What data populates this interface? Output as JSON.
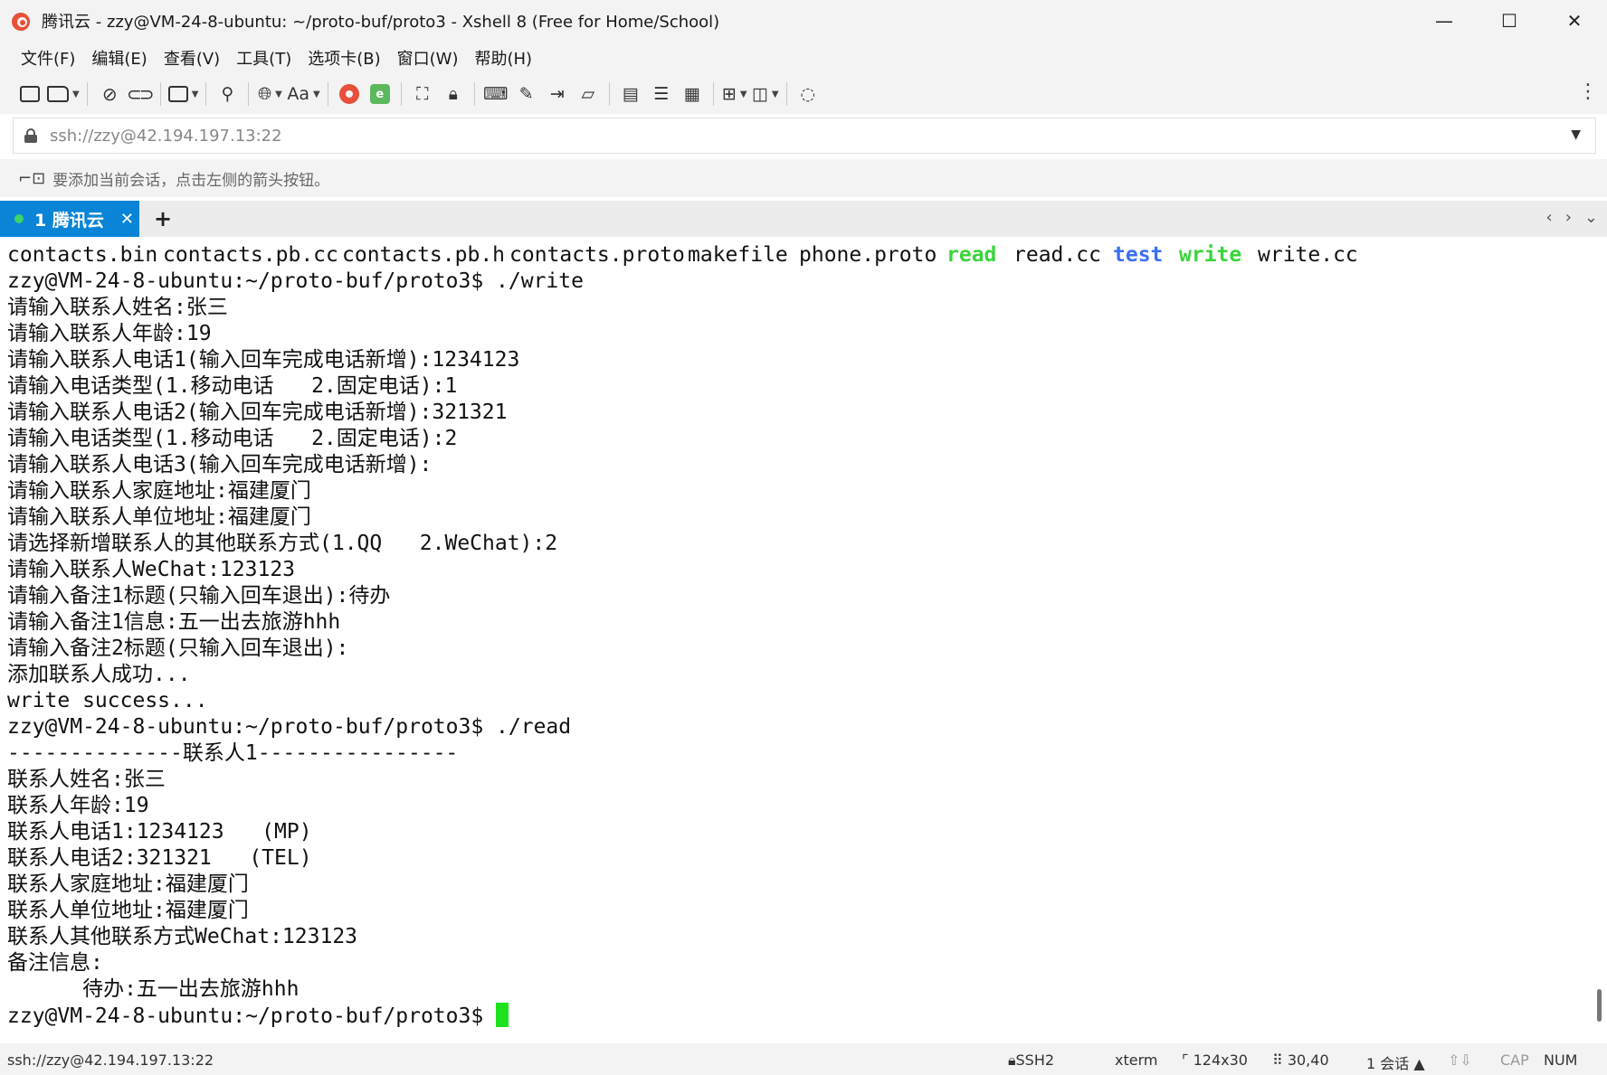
{
  "window": {
    "title": "腾讯云 - zzy@VM-24-8-ubuntu: ~/proto-buf/proto3 - Xshell 8 (Free for Home/School)",
    "app_icon": "xshell-logo-icon",
    "controls": {
      "minimize": "—",
      "maximize": "☐",
      "close": "✕"
    }
  },
  "menu": {
    "items": [
      "文件(F)",
      "编辑(E)",
      "查看(V)",
      "工具(T)",
      "选项卡(B)",
      "窗口(W)",
      "帮助(H)"
    ]
  },
  "toolbar": {
    "font_label": "Aa",
    "more": "⋮",
    "icons": [
      "new-session-icon",
      "open-folder-icon",
      "disconnect-icon",
      "reconnect-icon",
      "new-tab-icon",
      "search-icon",
      "globe-icon",
      "font-icon",
      "xshell-icon",
      "xftp-icon",
      "fullscreen-icon",
      "lock-icon",
      "keyboard-icon",
      "compose-icon",
      "transfer-icon",
      "script-icon",
      "run-script-icon",
      "log-icon",
      "layout-icon",
      "add-window-icon",
      "split-icon",
      "chat-icon"
    ]
  },
  "address": {
    "value": "ssh://zzy@42.194.197.13:22"
  },
  "hint": {
    "text": "要添加当前会话，点击左侧的箭头按钮。"
  },
  "tabs": [
    {
      "label": "1 腾讯云",
      "status": "connected",
      "active": true
    }
  ],
  "tab_add": "+",
  "tab_nav": {
    "prev": "‹",
    "next": "›",
    "menu": "⌄"
  },
  "terminal": {
    "ls_items": [
      {
        "text": "contacts.bin",
        "color": "default"
      },
      {
        "text": "contacts.pb.cc",
        "color": "default"
      },
      {
        "text": "contacts.pb.h",
        "color": "default"
      },
      {
        "text": "contacts.proto",
        "color": "default"
      },
      {
        "text": "makefile",
        "color": "default"
      },
      {
        "text": "phone.proto",
        "color": "default"
      },
      {
        "text": "read",
        "color": "green"
      },
      {
        "text": "read.cc",
        "color": "default"
      },
      {
        "text": "test",
        "color": "blue"
      },
      {
        "text": "write",
        "color": "green"
      },
      {
        "text": "write.cc",
        "color": "default"
      }
    ],
    "lines": [
      "zzy@VM-24-8-ubuntu:~/proto-buf/proto3$ ./write",
      "请输入联系人姓名:张三",
      "请输入联系人年龄:19",
      "请输入联系人电话1(输入回车完成电话新增):1234123",
      "请输入电话类型(1.移动电话   2.固定电话):1",
      "请输入联系人电话2(输入回车完成电话新增):321321",
      "请输入电话类型(1.移动电话   2.固定电话):2",
      "请输入联系人电话3(输入回车完成电话新增):",
      "请输入联系人家庭地址:福建厦门",
      "请输入联系人单位地址:福建厦门",
      "请选择新增联系人的其他联系方式(1.QQ   2.WeChat):2",
      "请输入联系人WeChat:123123",
      "请输入备注1标题(只输入回车退出):待办",
      "请输入备注1信息:五一出去旅游hhh",
      "请输入备注2标题(只输入回车退出):",
      "添加联系人成功...",
      "write success...",
      "zzy@VM-24-8-ubuntu:~/proto-buf/proto3$ ./read",
      "--------------联系人1----------------",
      "联系人姓名:张三",
      "联系人年龄:19",
      "联系人电话1:1234123   (MP)",
      "联系人电话2:321321   (TEL)",
      "联系人家庭地址:福建厦门",
      "联系人单位地址:福建厦门",
      "联系人其他联系方式WeChat:123123",
      "备注信息:",
      "      待办:五一出去旅游hhh"
    ],
    "prompt": "zzy@VM-24-8-ubuntu:~/proto-buf/proto3$ "
  },
  "statusbar": {
    "connection": "ssh://zzy@42.194.197.13:22",
    "protocol": "SSH2",
    "terminal_type": "xterm",
    "size": "124x30",
    "cursor_pos": "30,40",
    "sessions": "1 会话",
    "cap": "CAP",
    "num": "NUM"
  },
  "colors": {
    "tab_active": "#0a84d6",
    "ls_executable": "#3bd43b",
    "ls_directory": "#3a6ff2",
    "cursor": "#1ee21e"
  }
}
